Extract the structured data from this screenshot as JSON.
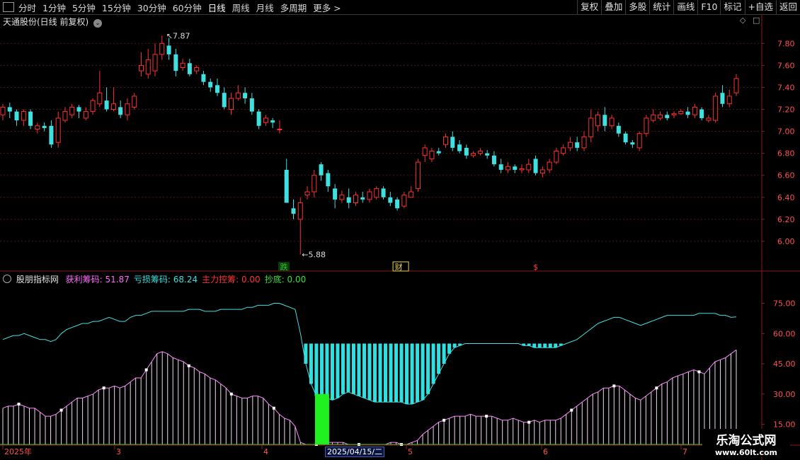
{
  "toolbar": {
    "periods": [
      "分时",
      "1分钟",
      "5分钟",
      "15分钟",
      "30分钟",
      "60分钟",
      "日线",
      "周线",
      "月线",
      "多周期",
      "更多 >"
    ],
    "active_period": "日线",
    "right_buttons": [
      "复权",
      "叠加",
      "多股",
      "统计",
      "画线",
      "F10",
      "标记",
      "+自选",
      "返回"
    ]
  },
  "main_panel": {
    "title": "天通股份(日线 前复权)",
    "price_axis": [
      "7.80",
      "7.60",
      "7.40",
      "7.20",
      "7.00",
      "6.80",
      "6.60",
      "6.40",
      "6.20",
      "6.00"
    ],
    "high_label": "7.87",
    "low_label": "5.88",
    "markers": [
      "跌",
      "财",
      "$"
    ],
    "marker_colors": {
      "跌": "#30c030",
      "财": "#e8d060",
      "$": "#ff4040"
    }
  },
  "indicator_panel": {
    "name": "股朋指标网",
    "lines": [
      {
        "label": "获利筹码: 51.87",
        "color": "#ff66ff"
      },
      {
        "label": "亏损筹码: 68.24",
        "color": "#33e0e0"
      },
      {
        "label": "主力控筹: 0.00",
        "color": "#ff3030"
      },
      {
        "label": "抄底: 0.00",
        "color": "#30e030"
      }
    ],
    "axis": [
      "75.00",
      "60.00",
      "45.00",
      "30.00",
      "15.00"
    ]
  },
  "time_axis": {
    "labels": [
      "2025年",
      "3",
      "4",
      "5",
      "6",
      "7"
    ],
    "cursor_date": "2025/04/15/二"
  },
  "watermark": {
    "line1": "乐淘公式网",
    "line2": "www.60lt.com"
  },
  "colors": {
    "up": "#ff3030",
    "down": "#40e0e0",
    "grid": "#5a1010",
    "axis": "#8a1a1a"
  },
  "chart_data": {
    "type": "candlestick",
    "ylim": [
      5.8,
      7.95
    ],
    "candles": [
      [
        7.15,
        7.22,
        7.25,
        7.1
      ],
      [
        7.22,
        7.18,
        7.26,
        7.12
      ],
      [
        7.18,
        7.1,
        7.2,
        7.05
      ],
      [
        7.1,
        7.18,
        7.2,
        7.05
      ],
      [
        7.18,
        7.05,
        7.2,
        7.02
      ],
      [
        7.02,
        7.05,
        7.08,
        6.98
      ],
      [
        7.05,
        7.03,
        7.08,
        7.0
      ],
      [
        7.05,
        6.88,
        7.1,
        6.85
      ],
      [
        6.9,
        7.12,
        7.18,
        6.85
      ],
      [
        7.1,
        7.18,
        7.22,
        7.08
      ],
      [
        7.15,
        7.22,
        7.25,
        7.12
      ],
      [
        7.22,
        7.18,
        7.24,
        7.12
      ],
      [
        7.12,
        7.18,
        7.22,
        7.1
      ],
      [
        7.18,
        7.28,
        7.3,
        7.15
      ],
      [
        7.25,
        7.35,
        7.55,
        7.22
      ],
      [
        7.28,
        7.2,
        7.4,
        7.18
      ],
      [
        7.2,
        7.25,
        7.4,
        7.18
      ],
      [
        7.22,
        7.15,
        7.28,
        7.12
      ],
      [
        7.15,
        7.25,
        7.3,
        7.1
      ],
      [
        7.22,
        7.32,
        7.35,
        7.2
      ],
      [
        7.55,
        7.6,
        7.72,
        7.5
      ],
      [
        7.52,
        7.65,
        7.75,
        7.48
      ],
      [
        7.55,
        7.7,
        7.8,
        7.5
      ],
      [
        7.7,
        7.8,
        7.87,
        7.65
      ],
      [
        7.78,
        7.7,
        7.85,
        7.65
      ],
      [
        7.7,
        7.55,
        7.75,
        7.5
      ],
      [
        7.58,
        7.62,
        7.66,
        7.55
      ],
      [
        7.62,
        7.52,
        7.66,
        7.5
      ],
      [
        7.55,
        7.58,
        7.6,
        7.52
      ],
      [
        7.52,
        7.45,
        7.55,
        7.42
      ],
      [
        7.45,
        7.4,
        7.48,
        7.36
      ],
      [
        7.42,
        7.35,
        7.48,
        7.32
      ],
      [
        7.35,
        7.22,
        7.4,
        7.2
      ],
      [
        7.2,
        7.3,
        7.35,
        7.15
      ],
      [
        7.3,
        7.35,
        7.42,
        7.28
      ],
      [
        7.35,
        7.3,
        7.4,
        7.25
      ],
      [
        7.3,
        7.18,
        7.35,
        7.15
      ],
      [
        7.18,
        7.05,
        7.2,
        7.02
      ],
      [
        7.08,
        7.12,
        7.15,
        7.05
      ],
      [
        7.1,
        7.08,
        7.12,
        7.03
      ],
      [
        7.02,
        7.02,
        7.1,
        6.98
      ],
      [
        6.65,
        6.35,
        6.75,
        6.35
      ],
      [
        6.3,
        6.25,
        6.38,
        6.2
      ],
      [
        6.2,
        6.35,
        6.4,
        5.88
      ],
      [
        6.42,
        6.45,
        6.5,
        6.38
      ],
      [
        6.45,
        6.6,
        6.65,
        6.4
      ],
      [
        6.7,
        6.6,
        6.72,
        6.55
      ],
      [
        6.62,
        6.5,
        6.65,
        6.45
      ],
      [
        6.48,
        6.38,
        6.52,
        6.3
      ],
      [
        6.38,
        6.42,
        6.46,
        6.35
      ],
      [
        6.4,
        6.35,
        6.48,
        6.3
      ],
      [
        6.35,
        6.42,
        6.45,
        6.32
      ],
      [
        6.4,
        6.38,
        6.45,
        6.35
      ],
      [
        6.38,
        6.45,
        6.48,
        6.35
      ],
      [
        6.4,
        6.48,
        6.5,
        6.38
      ],
      [
        6.48,
        6.4,
        6.5,
        6.38
      ],
      [
        6.4,
        6.35,
        6.45,
        6.32
      ],
      [
        6.38,
        6.3,
        6.4,
        6.28
      ],
      [
        6.32,
        6.42,
        6.45,
        6.3
      ],
      [
        6.4,
        6.45,
        6.5,
        6.4
      ],
      [
        6.48,
        6.72,
        6.75,
        6.45
      ],
      [
        6.78,
        6.85,
        6.88,
        6.72
      ],
      [
        6.75,
        6.82,
        6.85,
        6.72
      ],
      [
        6.82,
        6.8,
        6.85,
        6.78
      ],
      [
        6.88,
        6.95,
        6.98,
        6.85
      ],
      [
        6.95,
        6.85,
        7.0,
        6.82
      ],
      [
        6.88,
        6.82,
        6.92,
        6.8
      ],
      [
        6.85,
        6.78,
        6.88,
        6.75
      ],
      [
        6.78,
        6.8,
        6.82,
        6.76
      ],
      [
        6.8,
        6.82,
        6.85,
        6.78
      ],
      [
        6.8,
        6.78,
        6.83,
        6.75
      ],
      [
        6.78,
        6.7,
        6.82,
        6.68
      ],
      [
        6.7,
        6.65,
        6.75,
        6.62
      ],
      [
        6.65,
        6.68,
        6.72,
        6.62
      ],
      [
        6.68,
        6.65,
        6.7,
        6.62
      ],
      [
        6.65,
        6.66,
        6.7,
        6.62
      ],
      [
        6.65,
        6.7,
        6.75,
        6.62
      ],
      [
        6.75,
        6.62,
        6.78,
        6.6
      ],
      [
        6.62,
        6.65,
        6.68,
        6.58
      ],
      [
        6.65,
        6.72,
        6.75,
        6.62
      ],
      [
        6.72,
        6.82,
        6.85,
        6.7
      ],
      [
        6.8,
        6.85,
        6.88,
        6.78
      ],
      [
        6.85,
        6.9,
        6.95,
        6.82
      ],
      [
        6.9,
        6.85,
        6.95,
        6.82
      ],
      [
        6.85,
        6.95,
        7.0,
        6.82
      ],
      [
        6.95,
        7.12,
        7.2,
        6.9
      ],
      [
        7.05,
        7.15,
        7.18,
        7.0
      ],
      [
        7.15,
        7.05,
        7.22,
        7.0
      ],
      [
        7.05,
        7.12,
        7.15,
        7.02
      ],
      [
        7.05,
        6.98,
        7.08,
        6.95
      ],
      [
        6.98,
        6.9,
        7.0,
        6.88
      ],
      [
        6.9,
        6.88,
        6.92,
        6.85
      ],
      [
        6.85,
        6.98,
        7.0,
        6.82
      ],
      [
        6.98,
        7.12,
        7.15,
        6.95
      ],
      [
        7.1,
        7.15,
        7.2,
        7.08
      ],
      [
        7.12,
        7.15,
        7.18,
        7.1
      ],
      [
        7.15,
        7.12,
        7.18,
        7.1
      ],
      [
        7.15,
        7.16,
        7.18,
        7.12
      ],
      [
        7.16,
        7.18,
        7.2,
        7.15
      ],
      [
        7.18,
        7.15,
        7.22,
        7.12
      ],
      [
        7.15,
        7.22,
        7.25,
        7.12
      ],
      [
        7.2,
        7.12,
        7.22,
        7.1
      ],
      [
        7.1,
        7.12,
        7.15,
        7.08
      ],
      [
        7.1,
        7.32,
        7.35,
        7.08
      ],
      [
        7.35,
        7.25,
        7.42,
        7.22
      ],
      [
        7.25,
        7.32,
        7.38,
        7.22
      ],
      [
        7.35,
        7.48,
        7.52,
        7.32
      ]
    ],
    "indicator": {
      "ylim": [
        5,
        85
      ],
      "profit": [
        23,
        24,
        24,
        25,
        24,
        23,
        23,
        21,
        19,
        19,
        20,
        22,
        24,
        26,
        28,
        28,
        29,
        30,
        32,
        33,
        33,
        34,
        33,
        34,
        36,
        38,
        38,
        42,
        46,
        50,
        51,
        50,
        48,
        47,
        46,
        44,
        43,
        41,
        40,
        38,
        37,
        35,
        33,
        30,
        29,
        28,
        28,
        29,
        29,
        28,
        25,
        23,
        20,
        18,
        17,
        14,
        6,
        5,
        5,
        5,
        6,
        6,
        6,
        6,
        6,
        5,
        5,
        5,
        5,
        5,
        5,
        5,
        5,
        6,
        6,
        5,
        5,
        6,
        7,
        10,
        12,
        14,
        16,
        17,
        18,
        19,
        19,
        19,
        20,
        19,
        19,
        19,
        19,
        18,
        17,
        17,
        18,
        17,
        16,
        16,
        17,
        16,
        17,
        17,
        17,
        18,
        20,
        22,
        24,
        26,
        28,
        30,
        31,
        33,
        33,
        34,
        34,
        32,
        30,
        28,
        27,
        29,
        31,
        33,
        35,
        36,
        38,
        39,
        40,
        41,
        42,
        41,
        40,
        43,
        46,
        47,
        48,
        50,
        51.87
      ],
      "loss": [
        57,
        58,
        59,
        59,
        60,
        59,
        58,
        57,
        57,
        56,
        57,
        60,
        62,
        63,
        64,
        65,
        65,
        66,
        66,
        67,
        68,
        67,
        66,
        66,
        68,
        69,
        69,
        70,
        71,
        71,
        71,
        71,
        71,
        71,
        71,
        72,
        72,
        72,
        71,
        71,
        71,
        72,
        72,
        72,
        72,
        72,
        73,
        73,
        74,
        74,
        74,
        75,
        75,
        74,
        73,
        72,
        60,
        45,
        35,
        29,
        28,
        28,
        27,
        28,
        30,
        31,
        30,
        29,
        28,
        27,
        26,
        26,
        26,
        26,
        26,
        26,
        25,
        25,
        26,
        27,
        30,
        35,
        40,
        45,
        50,
        53,
        54,
        55,
        55,
        55,
        55,
        55,
        55,
        55,
        55,
        55,
        55,
        55,
        54,
        54,
        53,
        53,
        53,
        53,
        53,
        54,
        55,
        56,
        57,
        59,
        61,
        63,
        65,
        66,
        67,
        68,
        68,
        67,
        66,
        65,
        64,
        65,
        66,
        67,
        68,
        69,
        69,
        69,
        69,
        69,
        69,
        70,
        70,
        70,
        70,
        69,
        69,
        68,
        68.24
      ],
      "green_bar": {
        "index": 59,
        "value": 30
      }
    }
  }
}
